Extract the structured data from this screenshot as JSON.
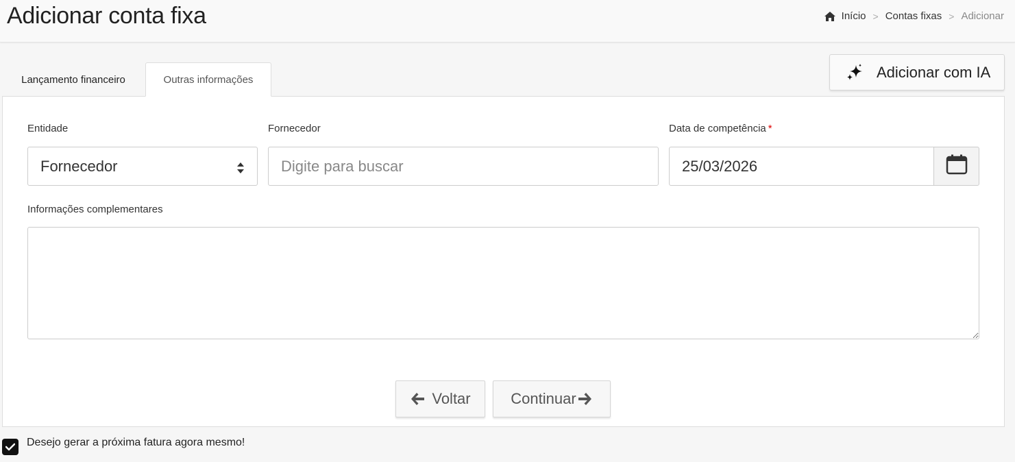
{
  "header": {
    "title": "Adicionar conta fixa",
    "breadcrumb": {
      "home_icon": "home-icon",
      "items": [
        "Início",
        "Contas fixas",
        "Adicionar"
      ],
      "separator": ">"
    }
  },
  "tabs": [
    {
      "label": "Lançamento financeiro",
      "active": false
    },
    {
      "label": "Outras informações",
      "active": true
    }
  ],
  "ia_button": {
    "label": "Adicionar com IA",
    "icon": "sparkle-icon"
  },
  "form": {
    "entity": {
      "label": "Entidade",
      "value": "Fornecedor"
    },
    "supplier": {
      "label": "Fornecedor",
      "value": "",
      "placeholder": "Digite para buscar"
    },
    "competence_date": {
      "label": "Data de competência",
      "required_mark": "*",
      "value": "25/03/2026",
      "icon": "calendar-icon"
    },
    "notes": {
      "label": "Informações complementares",
      "value": ""
    }
  },
  "actions": {
    "back_label": "Voltar",
    "next_label": "Continuar"
  },
  "generate_invoice": {
    "label": "Desejo gerar a próxima fatura agora mesmo!",
    "checked": true
  }
}
